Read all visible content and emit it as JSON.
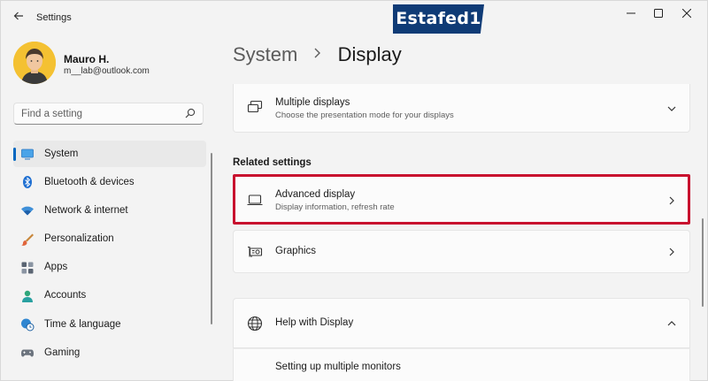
{
  "window": {
    "app_title": "Settings",
    "watermark": "Estafed1"
  },
  "profile": {
    "name": "Mauro H.",
    "email": "m__lab@outlook.com"
  },
  "search": {
    "placeholder": "Find a setting"
  },
  "sidebar": {
    "items": [
      {
        "label": "System",
        "icon": "monitor-icon",
        "active": true
      },
      {
        "label": "Bluetooth & devices",
        "icon": "bluetooth-icon"
      },
      {
        "label": "Network & internet",
        "icon": "wifi-icon"
      },
      {
        "label": "Personalization",
        "icon": "brush-icon"
      },
      {
        "label": "Apps",
        "icon": "apps-icon"
      },
      {
        "label": "Accounts",
        "icon": "person-icon"
      },
      {
        "label": "Time & language",
        "icon": "globe-clock-icon"
      },
      {
        "label": "Gaming",
        "icon": "gamepad-icon"
      }
    ]
  },
  "breadcrumb": {
    "parent": "System",
    "current": "Display"
  },
  "main": {
    "multiple_displays": {
      "title": "Multiple displays",
      "subtitle": "Choose the presentation mode for your displays"
    },
    "related_heading": "Related settings",
    "advanced_display": {
      "title": "Advanced display",
      "subtitle": "Display information, refresh rate"
    },
    "graphics": {
      "title": "Graphics"
    },
    "help": {
      "title": "Help with Display",
      "link": "Setting up multiple monitors"
    }
  },
  "colors": {
    "accent": "#0067c0",
    "highlight": "#c8102e",
    "avatar_bg": "#f4c132",
    "watermark_bg": "#0f3b76"
  }
}
